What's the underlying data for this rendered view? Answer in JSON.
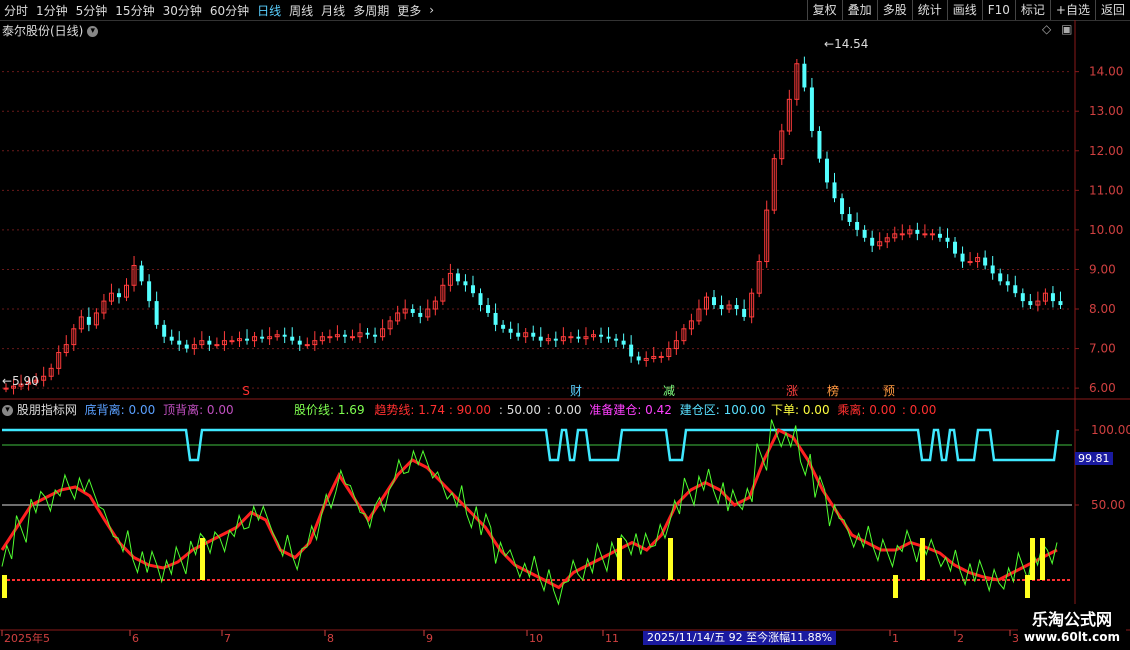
{
  "toolbar": {
    "periods": [
      "分时",
      "1分钟",
      "5分钟",
      "15分钟",
      "30分钟",
      "60分钟",
      "日线",
      "周线",
      "月线",
      "多周期",
      "更多"
    ],
    "active_period": "日线",
    "more_icon": "chevron-right-icon",
    "right_buttons": [
      "复权",
      "叠加",
      "多股",
      "统计",
      "画线",
      "F10",
      "标记",
      "+自选",
      "返回"
    ]
  },
  "main_chart": {
    "title": "泰尔股份(日线)",
    "max_label": "14.54",
    "min_label": "5.90",
    "price_ticks": [
      "14.00",
      "13.00",
      "12.00",
      "11.00",
      "10.00",
      "9.00",
      "8.00",
      "7.00",
      "6.00"
    ],
    "markers": [
      {
        "text": "S",
        "color": "#ff3030"
      },
      {
        "text": "财",
        "color": "#5ad0ff"
      },
      {
        "text": "减",
        "color": "#7fff7f"
      },
      {
        "text": "涨",
        "color": "#ff4040"
      },
      {
        "text": "榜",
        "color": "#ff9a40"
      },
      {
        "text": "预",
        "color": "#ff9a40"
      }
    ]
  },
  "indicator": {
    "name": "股朋指标网",
    "bottom_div_label": "底背离: 0.00",
    "top_div_label": "顶背离: 0.00",
    "price_line": "股价线: 1.69",
    "trend_line": "趋势线: 1.74",
    "v90": ": 90.00",
    "v50": ": 50.00",
    "v0": ": 0.00",
    "prepare": "准备建仓: 0.42",
    "build_zone": "建仓区: 100.00",
    "order": "下单: 0.00",
    "leave": "乘离: 0.00",
    "leave2": ": 0.00",
    "current_value": "99.81",
    "ticks": [
      "100.00",
      "50.00"
    ]
  },
  "date_axis": {
    "labels": [
      "2025年5",
      "6",
      "7",
      "8",
      "9",
      "10",
      "11",
      "1",
      "2",
      "3"
    ],
    "info": "2025/11/14/五  92 至今涨幅11.88%"
  },
  "watermark": {
    "line1": "乐淘公式网",
    "line2": "www.60lt.com"
  },
  "chart_data": {
    "type": "candlestick",
    "title": "泰尔股份(日线)",
    "ylim": [
      5.7,
      14.8
    ],
    "x": [
      "2025年5",
      "6",
      "7",
      "8",
      "9",
      "10",
      "11",
      "1",
      "2",
      "3"
    ],
    "y_max": 14.54,
    "y_min": 5.9,
    "close": [
      6.0,
      6.05,
      6.1,
      6.15,
      6.2,
      6.3,
      6.5,
      6.9,
      7.1,
      7.5,
      7.8,
      7.6,
      7.9,
      8.2,
      8.4,
      8.3,
      8.6,
      9.1,
      8.7,
      8.2,
      7.6,
      7.3,
      7.2,
      7.1,
      7.0,
      7.1,
      7.2,
      7.1,
      7.1,
      7.2,
      7.2,
      7.25,
      7.2,
      7.3,
      7.25,
      7.3,
      7.35,
      7.3,
      7.2,
      7.1,
      7.1,
      7.2,
      7.3,
      7.3,
      7.35,
      7.3,
      7.3,
      7.4,
      7.35,
      7.3,
      7.5,
      7.7,
      7.9,
      8.0,
      7.9,
      7.8,
      8.0,
      8.2,
      8.6,
      8.9,
      8.7,
      8.6,
      8.4,
      8.1,
      7.9,
      7.6,
      7.5,
      7.4,
      7.3,
      7.4,
      7.3,
      7.2,
      7.25,
      7.2,
      7.3,
      7.3,
      7.25,
      7.3,
      7.35,
      7.3,
      7.25,
      7.2,
      7.1,
      6.8,
      6.7,
      6.75,
      6.8,
      6.8,
      7.0,
      7.2,
      7.5,
      7.7,
      8.0,
      8.3,
      8.1,
      8.0,
      8.1,
      8.0,
      7.8,
      8.4,
      9.2,
      10.5,
      11.8,
      12.5,
      13.3,
      14.2,
      13.6,
      12.5,
      11.8,
      11.2,
      10.8,
      10.4,
      10.2,
      10.0,
      9.8,
      9.6,
      9.7,
      9.8,
      9.9,
      9.9,
      10.0,
      9.9,
      9.9,
      9.9,
      9.8,
      9.7,
      9.4,
      9.2,
      9.2,
      9.3,
      9.1,
      8.9,
      8.7,
      8.6,
      8.4,
      8.2,
      8.1,
      8.2,
      8.4,
      8.2,
      8.1
    ]
  }
}
